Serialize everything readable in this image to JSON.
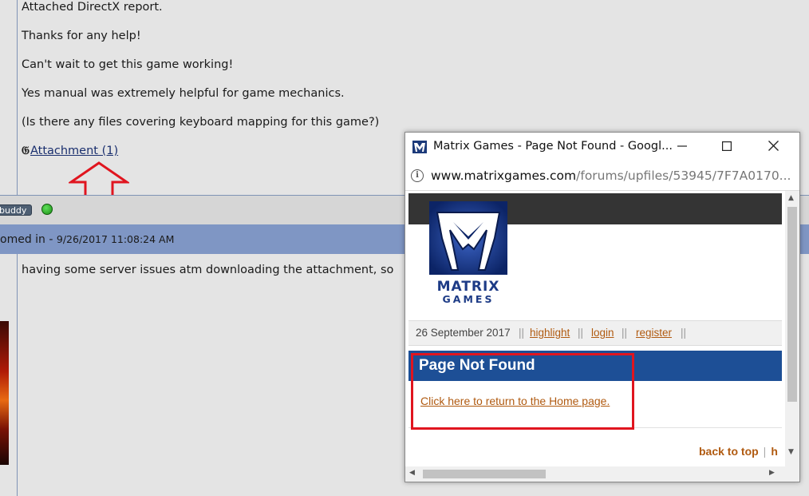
{
  "post": {
    "lines": [
      "Attached DirectX report.",
      "Thanks for any help!",
      "Can't wait to get this game working!",
      "Yes manual was extremely helpful for game mechanics.",
      "(Is there any files covering keyboard mapping for this game?)"
    ],
    "attachment_label": "Attachment (1)"
  },
  "user_bar": {
    "buddy_label": "buddy",
    "status_color": "#2db526"
  },
  "reply_header": {
    "prefix": "omed in - ",
    "timestamp": "9/26/2017 11:08:24 AM"
  },
  "reply": {
    "text": "having some server issues atm downloading the attachment, so"
  },
  "popup": {
    "title": "Matrix Games - Page Not Found - Googl...",
    "url_host": "www.matrixgames.com",
    "url_path": "/forums/upfiles/53945/7F7A0170...",
    "logo": {
      "line1": "MATRIX",
      "line2": "GAMES"
    },
    "nav": {
      "date": "26 September 2017",
      "separator": "||",
      "links": [
        "highlight",
        "login",
        "register"
      ]
    },
    "heading": "Page Not Found",
    "home_link": "Click here to return to the Home page.",
    "back_to_top": "back to top",
    "footer_sep": "|",
    "footer_partial": "h"
  },
  "colors": {
    "annotation_red": "#e0151f",
    "header_blue": "#1d4f96",
    "link_orange": "#b05a10",
    "forum_bar_blue": "#7f96c4"
  },
  "icons": {
    "minimize": "minimize-icon",
    "maximize": "maximize-icon",
    "close": "close-icon",
    "info": "info-icon",
    "attachment": "paperclip-icon",
    "arrow": "up-arrow-annotation"
  }
}
